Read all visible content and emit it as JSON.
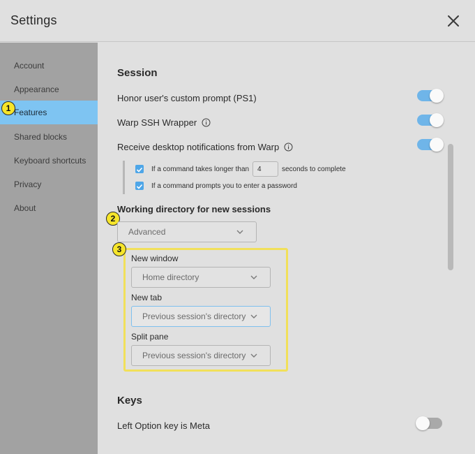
{
  "window": {
    "title": "Settings"
  },
  "sidebar": {
    "items": [
      {
        "label": "Account"
      },
      {
        "label": "Appearance"
      },
      {
        "label": "Features"
      },
      {
        "label": "Shared blocks"
      },
      {
        "label": "Keyboard shortcuts"
      },
      {
        "label": "Privacy"
      },
      {
        "label": "About"
      }
    ],
    "active": "Features"
  },
  "session": {
    "heading": "Session",
    "honor_prompt": {
      "label": "Honor user's custom prompt (PS1)",
      "enabled": true
    },
    "ssh_wrapper": {
      "label": "Warp SSH Wrapper",
      "enabled": true
    },
    "notifications": {
      "label": "Receive desktop notifications from Warp",
      "enabled": true,
      "long_command": {
        "prefix": "If a command takes longer than",
        "seconds": "4",
        "suffix": "seconds to complete",
        "checked": true
      },
      "password_prompt": {
        "label": "If a command prompts you to enter a password",
        "checked": true
      }
    },
    "working_dir": {
      "heading": "Working directory for new sessions",
      "mode": "Advanced",
      "new_window": {
        "label": "New window",
        "value": "Home directory"
      },
      "new_tab": {
        "label": "New tab",
        "value": "Previous session's directory"
      },
      "split_pane": {
        "label": "Split pane",
        "value": "Previous session's directory"
      }
    }
  },
  "keys": {
    "heading": "Keys",
    "option_meta": {
      "label": "Left Option key is Meta",
      "enabled": false
    }
  },
  "badges": [
    "1",
    "2",
    "3"
  ],
  "colors": {
    "accent": "#7ec4f2",
    "toggle_on": "#6fb5e9",
    "highlight": "#f1e05a",
    "badge": "#f6e52a"
  }
}
